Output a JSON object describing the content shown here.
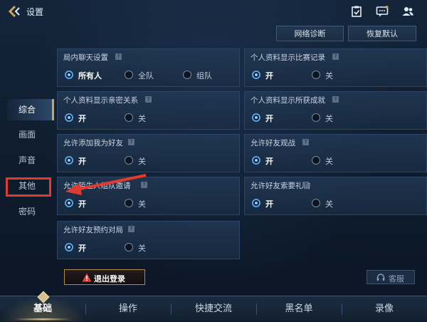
{
  "header": {
    "title": "设置",
    "icons": [
      "back-chevron-icon",
      "task-clipboard-icon",
      "chat-message-icon",
      "friends-icon"
    ]
  },
  "actions": {
    "network_diag": "网络诊断",
    "restore_default": "恢复默认"
  },
  "sidebar": {
    "items": [
      {
        "label": "综合",
        "active": true
      },
      {
        "label": "画面",
        "active": false
      },
      {
        "label": "声音",
        "active": false
      },
      {
        "label": "其他",
        "active": false
      },
      {
        "label": "密码",
        "active": false
      }
    ]
  },
  "settings": [
    {
      "title": "局内聊天设置",
      "options": [
        "所有人",
        "全队",
        "组队"
      ],
      "selected": 0
    },
    {
      "title": "个人资料显示比赛记录",
      "options": [
        "开",
        "关"
      ],
      "selected": 0
    },
    {
      "title": "个人资料显示亲密关系",
      "options": [
        "开",
        "关"
      ],
      "selected": 0
    },
    {
      "title": "个人资料显示所获成就",
      "options": [
        "开",
        "关"
      ],
      "selected": 0
    },
    {
      "title": "允许添加我为好友",
      "options": [
        "开",
        "关"
      ],
      "selected": 0
    },
    {
      "title": "允许好友观战",
      "options": [
        "开",
        "关"
      ],
      "selected": 0
    },
    {
      "title": "允许陌生人组队邀请",
      "options": [
        "开",
        "关"
      ],
      "selected": 0
    },
    {
      "title": "允许好友索要礼物",
      "options": [
        "开",
        "关"
      ],
      "selected": 0
    },
    {
      "title": "允许好友预约对局",
      "options": [
        "开",
        "关"
      ],
      "selected": 0
    }
  ],
  "footer": {
    "logout": "退出登录",
    "customer_service": "客服"
  },
  "tabs": [
    {
      "label": "基础",
      "active": true
    },
    {
      "label": "操作",
      "active": false
    },
    {
      "label": "快捷交流",
      "active": false
    },
    {
      "label": "黑名单",
      "active": false
    },
    {
      "label": "录像",
      "active": false
    }
  ],
  "colors": {
    "accent_blue": "#4ea6ec",
    "gold": "#d8c088",
    "annotation_red": "#e23a2c"
  }
}
